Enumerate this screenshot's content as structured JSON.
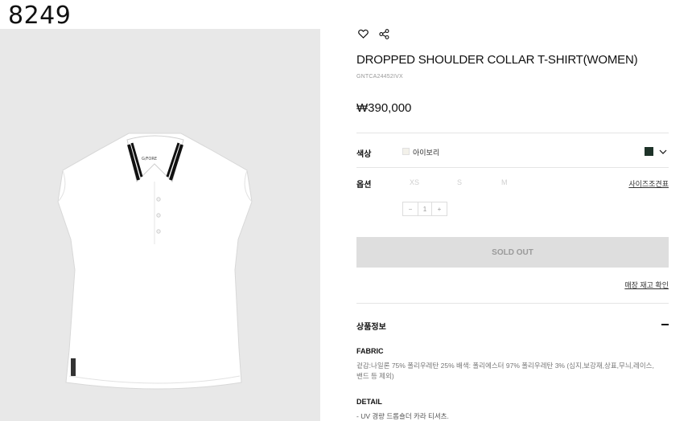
{
  "overlay_id": "8249",
  "product": {
    "title": "DROPPED SHOULDER COLLAR T-SHIRT(WOMEN)",
    "code": "GNTCA24452IVX",
    "price": "₩390,000",
    "image_brand_text": "G/FORE"
  },
  "icons": {
    "wishlist": "heart-icon",
    "share": "share-icon"
  },
  "color": {
    "label": "색상",
    "selected": "아이보리",
    "chip_color": "#1e3329"
  },
  "option": {
    "label": "옵션",
    "sizes": [
      "XS",
      "S",
      "M"
    ],
    "size_guide": "사이즈조견표"
  },
  "quantity": {
    "minus": "−",
    "value": "1",
    "plus": "+"
  },
  "sold_out_label": "SOLD OUT",
  "store_stock_link": "매장 재고 확인",
  "product_info": {
    "title": "상품정보",
    "fabric_title": "FABRIC",
    "fabric_line1": "겉감:나일론 75% 폴리우레탄 25% 배색: 폴리에스터 97% 폴리우레탄 3% (심지,보강재,상표,무늬,레이스,",
    "fabric_line2": "밴드 등 제외)",
    "detail_title": "DETAIL",
    "detail_line1": "- UV 경량 드롭숄더 카라 티셔츠."
  }
}
